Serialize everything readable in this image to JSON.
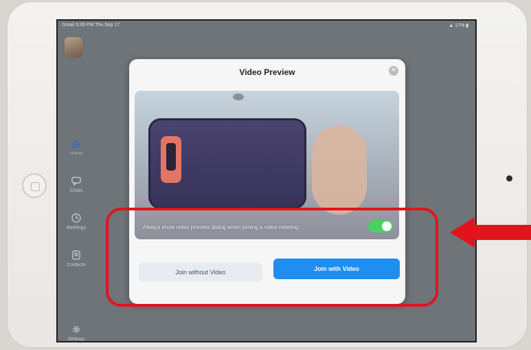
{
  "status_bar": {
    "left": "Gmail 5:35 PM  Thu Sep 17",
    "right": "17%"
  },
  "sidebar": {
    "items": [
      {
        "label": "Home"
      },
      {
        "label": "Chats"
      },
      {
        "label": "Meetings"
      },
      {
        "label": "Contacts"
      },
      {
        "label": "Settings"
      }
    ]
  },
  "modal": {
    "title": "Video Preview",
    "toggle_label": "Always show video preview dialog when joining a video meeting",
    "toggle_on": true,
    "join_without_video": "Join without Video",
    "join_with_video": "Join with Video"
  },
  "colors": {
    "primary_button": "#1e8ef0",
    "toggle_on": "#4bd15f",
    "annotation_red": "#e1141e"
  },
  "icons": [
    "home-icon",
    "chat-icon",
    "clock-icon",
    "contacts-icon",
    "gear-icon",
    "close-icon",
    "wifi-icon",
    "battery-icon"
  ]
}
